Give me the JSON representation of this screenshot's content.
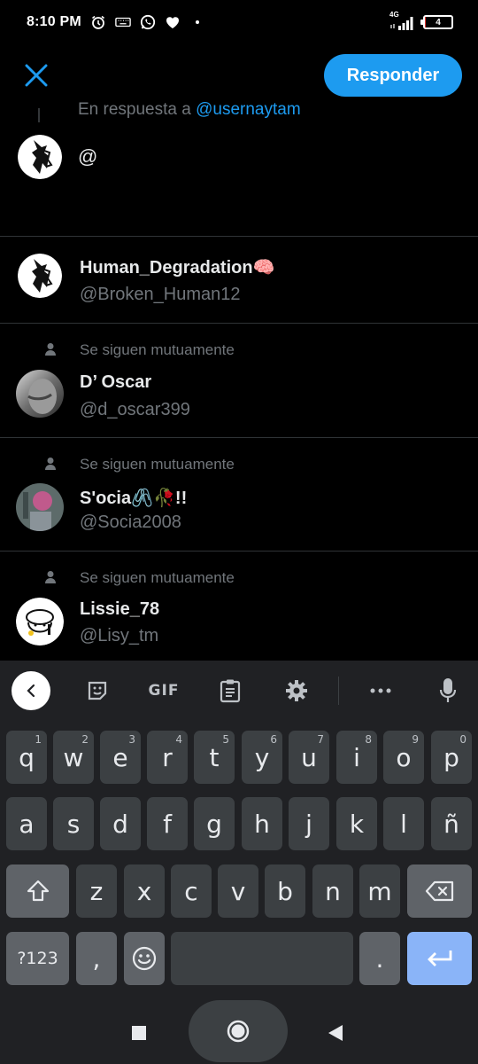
{
  "status_bar": {
    "time": "8:10 PM",
    "network": "4G",
    "battery": "4",
    "battery_level_percent": 4,
    "icons": [
      "alarm-icon",
      "keyboard-icon",
      "whatsapp-icon",
      "heart-icon",
      "dot-icon",
      "signal-icon"
    ]
  },
  "header": {
    "reply_button": "Responder",
    "close_icon": "close-icon"
  },
  "reply_context": {
    "prefix": "En respuesta a",
    "handle": "@usernaytam"
  },
  "compose": {
    "text": "@"
  },
  "suggestions": [
    {
      "mutual": "",
      "name": "Human_Degradation🧠",
      "handle": "@Broken_Human12"
    },
    {
      "mutual": "Se siguen mutuamente",
      "name": "D’ Oscar",
      "handle": "@d_oscar399"
    },
    {
      "mutual": "Se siguen mutuamente",
      "name": "S'ocia🖇️🥀!!",
      "handle": "@Socia2008"
    },
    {
      "mutual": "Se siguen mutuamente",
      "name": "Lissie_78",
      "handle": "@Lisy_tm"
    }
  ],
  "keyboard": {
    "toolbar": {
      "gif": "GIF",
      "icons": [
        "back-icon",
        "sticker-icon",
        "gif-icon",
        "clipboard-icon",
        "settings-icon",
        "more-icon",
        "mic-icon"
      ]
    },
    "row1": [
      "q",
      "w",
      "e",
      "r",
      "t",
      "y",
      "u",
      "i",
      "o",
      "p"
    ],
    "row1_hints": [
      "1",
      "2",
      "3",
      "4",
      "5",
      "6",
      "7",
      "8",
      "9",
      "0"
    ],
    "row2": [
      "a",
      "s",
      "d",
      "f",
      "g",
      "h",
      "j",
      "k",
      "l",
      "ñ"
    ],
    "row3": [
      "z",
      "x",
      "c",
      "v",
      "b",
      "n",
      "m"
    ],
    "row4": {
      "symbols": "?123",
      "comma": ",",
      "period": "."
    }
  },
  "colors": {
    "accent": "#1d9bf0",
    "background": "#000000",
    "keyboard_bg": "#202124",
    "key_bg": "#3c4043",
    "enter_key": "#8ab4f8"
  }
}
